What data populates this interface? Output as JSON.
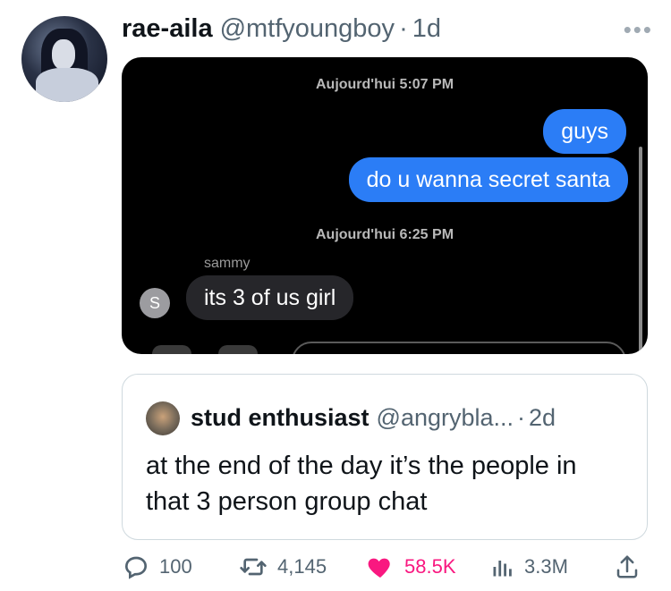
{
  "tweet": {
    "display_name": "rae-aila",
    "handle": "@mtfyoungboy",
    "separator": "·",
    "time": "1d",
    "more_icon": "more-horizontal-icon"
  },
  "screenshot": {
    "timestamps": [
      "Aujourd'hui 5:07 PM",
      "Aujourd'hui 6:25 PM"
    ],
    "outgoing": [
      "guys",
      "do u wanna secret santa"
    ],
    "sender_name": "sammy",
    "sender_initial": "S",
    "incoming": [
      "its 3 of us girl"
    ],
    "colors": {
      "outgoing_bubble": "#2b7df6",
      "incoming_bubble": "#26262a",
      "background": "#000000"
    }
  },
  "quote": {
    "display_name": "stud enthusiast",
    "handle": "@angrybla...",
    "separator": "·",
    "time": "2d",
    "text": "at the end of the day it’s the people in that 3 person group chat"
  },
  "actions": {
    "replies": "100",
    "retweets": "4,145",
    "likes": "58.5K",
    "views": "3.3M",
    "icons": [
      "reply-icon",
      "retweet-icon",
      "heart-icon",
      "views-icon",
      "share-icon"
    ],
    "like_color": "#f91880"
  }
}
